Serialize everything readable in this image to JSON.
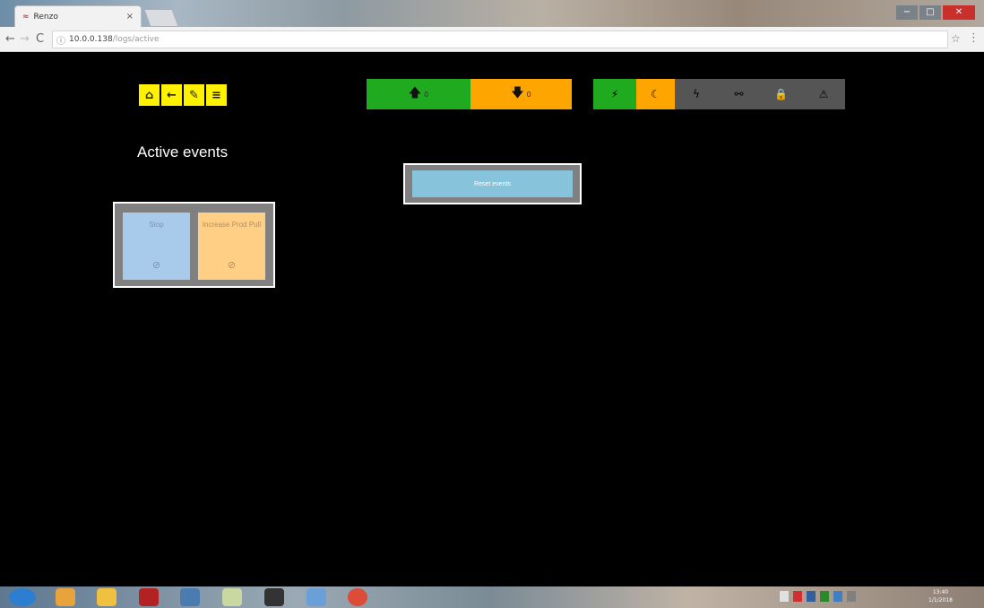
{
  "browser": {
    "tab": {
      "title": "Renzo",
      "favicon": "renzo-logo-icon",
      "close": "×"
    },
    "nav": {
      "back": "←",
      "forward": "→",
      "reload": "C"
    },
    "address": {
      "info_icon": "ⓘ",
      "host": "10.0.0.138",
      "path": "/logs/active"
    },
    "bookmark": "☆",
    "menu": "⋮",
    "window_controls": {
      "minimize": "−",
      "maximize": "□",
      "close": "✕"
    }
  },
  "toolbar": {
    "home": "⌂",
    "back": "←",
    "settings": "✎",
    "menu": "≡"
  },
  "status": {
    "up": {
      "icon": "🡅",
      "count": "0",
      "color": "#1faa1f"
    },
    "down": {
      "icon": "🡇",
      "count": "0",
      "color": "#ffa500"
    }
  },
  "indicators": [
    {
      "name": "plug-icon",
      "glyph": "⚡",
      "color": "#1faa1f"
    },
    {
      "name": "moon-icon",
      "glyph": "☾",
      "color": "#ffa500"
    },
    {
      "name": "lightning-icon",
      "glyph": "ϟ",
      "color": "#555555"
    },
    {
      "name": "link-icon",
      "glyph": "⚯",
      "color": "#555555"
    },
    {
      "name": "lock-icon",
      "glyph": "🔒",
      "color": "#555555"
    },
    {
      "name": "warning-icon",
      "glyph": "⚠",
      "color": "#555555"
    }
  ],
  "page": {
    "heading": "Active events"
  },
  "reset": {
    "label": "Reset events"
  },
  "events": [
    {
      "label": "Stop",
      "check": "⊘"
    },
    {
      "label": "Increase Prod Pull",
      "check": "⊘"
    }
  ],
  "taskbar": {
    "clock_time": "13:40",
    "clock_date": "1/1/2018"
  }
}
